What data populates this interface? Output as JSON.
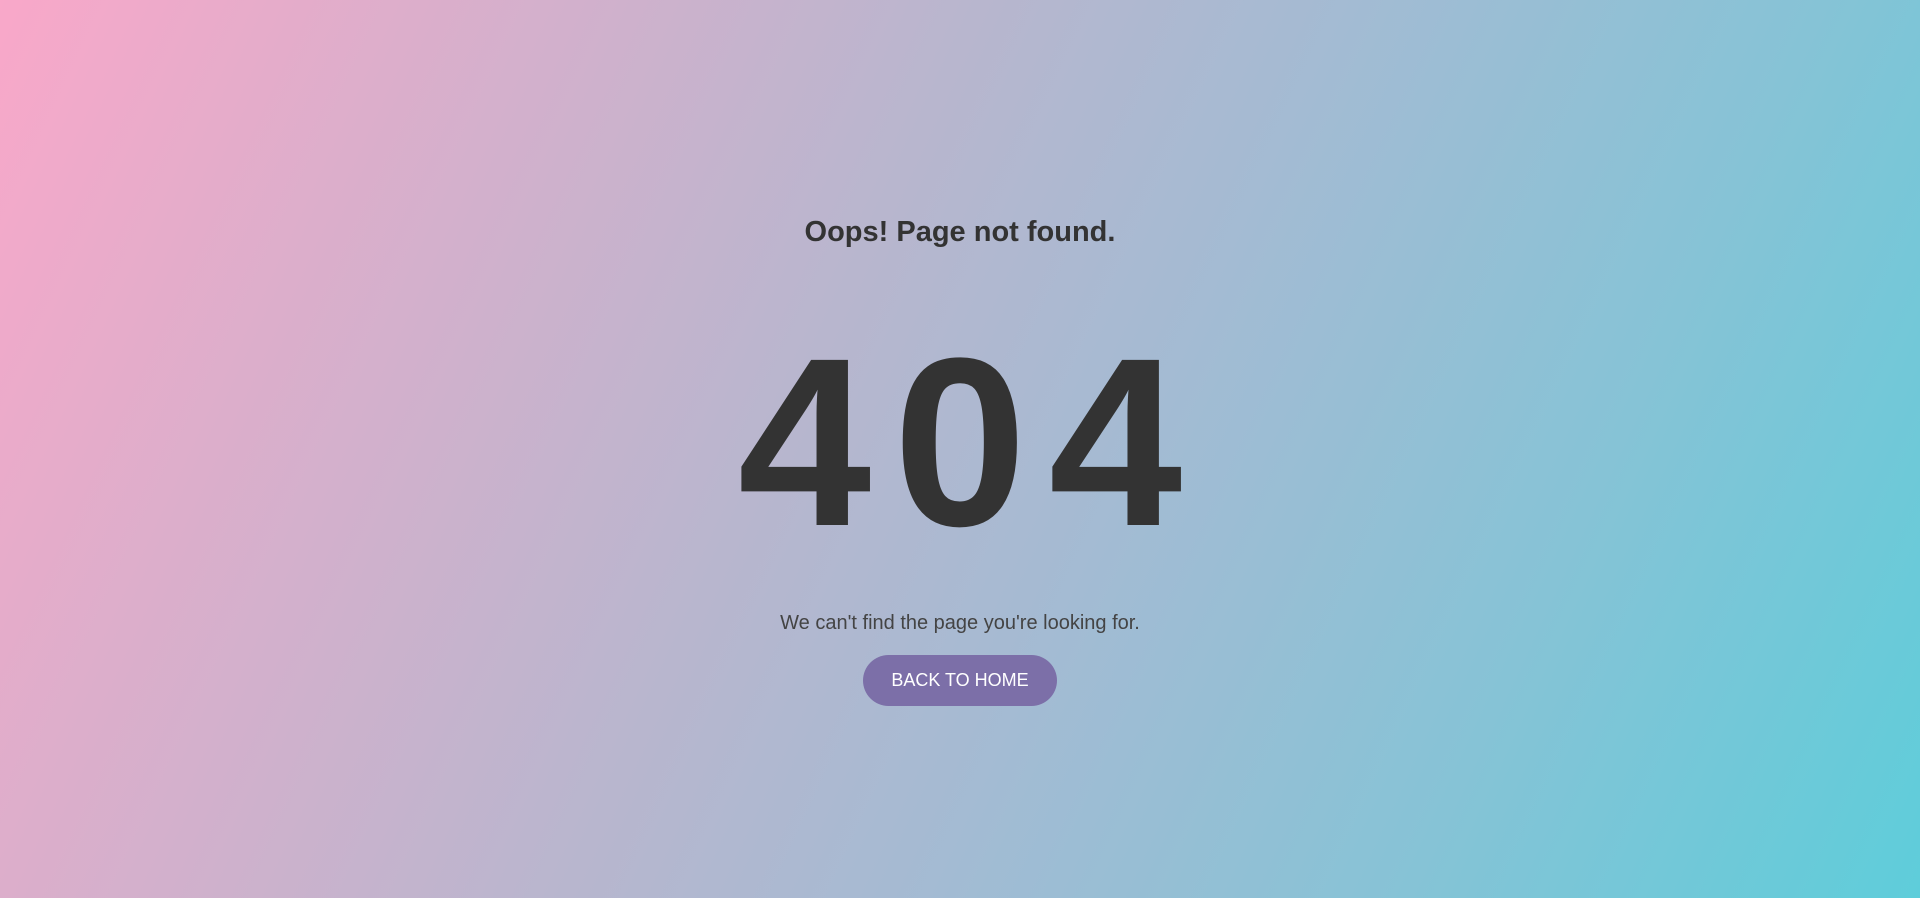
{
  "page": {
    "heading": "Oops! Page not found.",
    "error_code": "404",
    "message": "We can't find the page you're looking for.",
    "back_button_label": "BACK TO HOME"
  },
  "colors": {
    "text": "#333333",
    "button_bg": "#7c6fa8",
    "button_text": "#ffffff",
    "gradient_start": "#f9a8c9",
    "gradient_end": "#5ecdda"
  }
}
